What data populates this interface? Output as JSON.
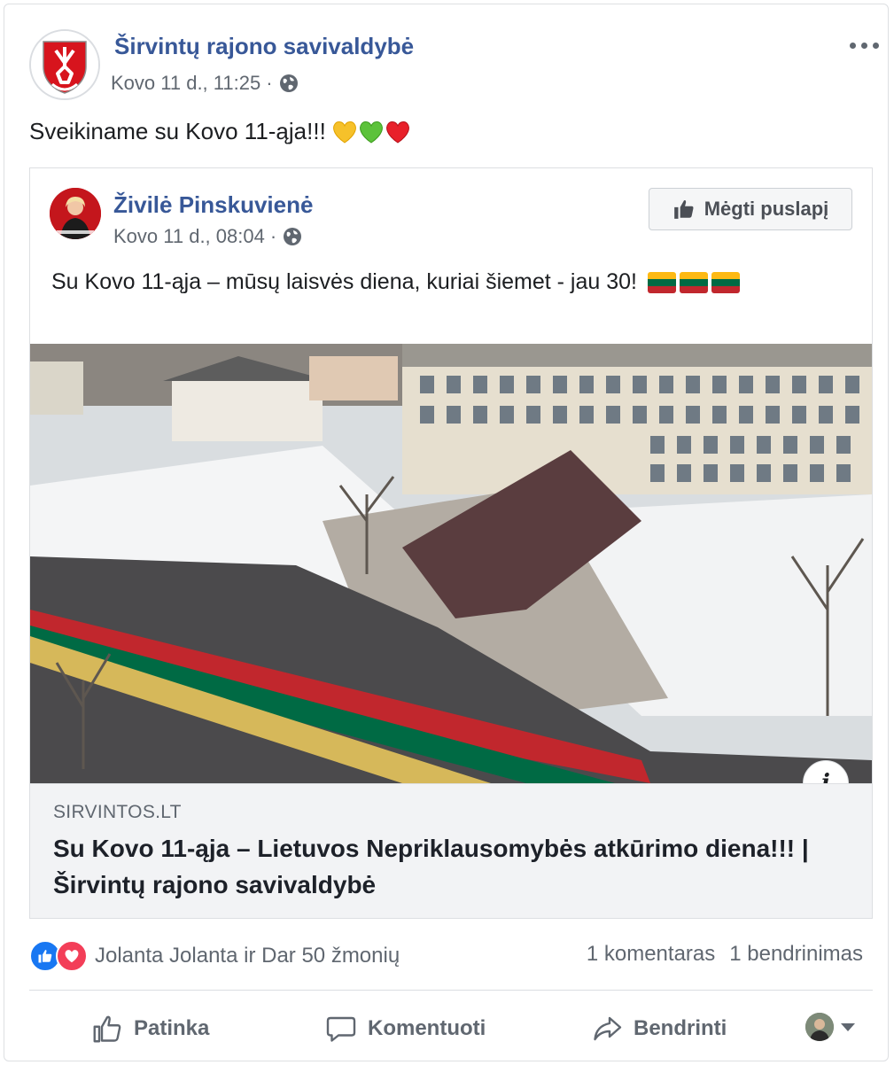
{
  "post": {
    "page_name": "Širvintų rajono savivaldybė",
    "timestamp": "Kovo 11 d., 11:25",
    "separator": "·",
    "audience_icon": "globe-icon",
    "text": "Sveikiname su Kovo 11-ąja!!!",
    "emojis": [
      "yellow-heart-icon",
      "green-heart-icon",
      "red-heart-icon"
    ]
  },
  "shared": {
    "author_name": "Živilė Pinskuvienė",
    "timestamp": "Kovo 11 d., 08:04",
    "separator": "·",
    "like_page_label": "Mėgti puslapį",
    "text": "Su Kovo 11-ąja – mūsų laisvės diena, kuriai šiemet - jau 30!",
    "flags_count": 3,
    "link": {
      "domain": "SIRVINTOS.LT",
      "title": "Su Kovo 11-ąja – Lietuvos Nepriklausomybės atkūrimo diena!!! | Širvintų rajono savivaldybė",
      "info_label": "i"
    }
  },
  "reactions": {
    "names": "Jolanta Jolanta ir Dar 50 žmonių",
    "comments": "1 komentaras",
    "shares": "1 bendrinimas"
  },
  "actions": {
    "like": "Patinka",
    "comment": "Komentuoti",
    "share": "Bendrinti"
  },
  "colors": {
    "link_blue": "#385898",
    "meta_gray": "#606770",
    "like_blue": "#1877f2",
    "love_red": "#f33e58",
    "flag_yellow": "#fdb913",
    "flag_green": "#006a44",
    "flag_red": "#c1272d"
  }
}
